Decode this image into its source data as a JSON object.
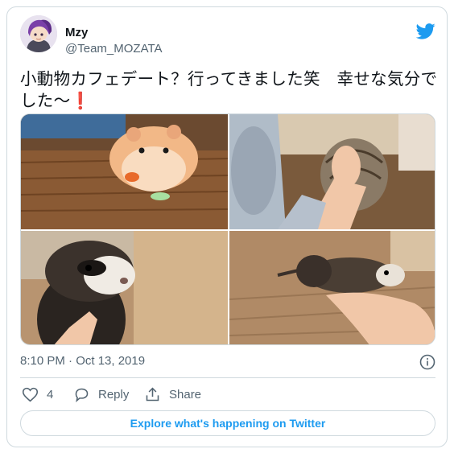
{
  "author": {
    "name": "Mzy",
    "handle": "@Team_MOZATA"
  },
  "tweet": {
    "text": "小動物カフェデート？行ってきました笑　幸せな気分でした〜",
    "emoji": "❗"
  },
  "media": {
    "photos": [
      {
        "subject": "hamster-photo"
      },
      {
        "subject": "meerkat-photo"
      },
      {
        "subject": "ferret-closeup-photo"
      },
      {
        "subject": "ferret-hand-photo"
      }
    ]
  },
  "meta": {
    "timestamp": "8:10 PM · Oct 13, 2019"
  },
  "actions": {
    "like_count": "4",
    "reply_label": "Reply",
    "share_label": "Share"
  },
  "explore": {
    "label": "Explore what's happening on Twitter"
  },
  "colors": {
    "twitter_blue": "#1d9bf0",
    "secondary_text": "#536471",
    "border": "#cfd9de"
  }
}
